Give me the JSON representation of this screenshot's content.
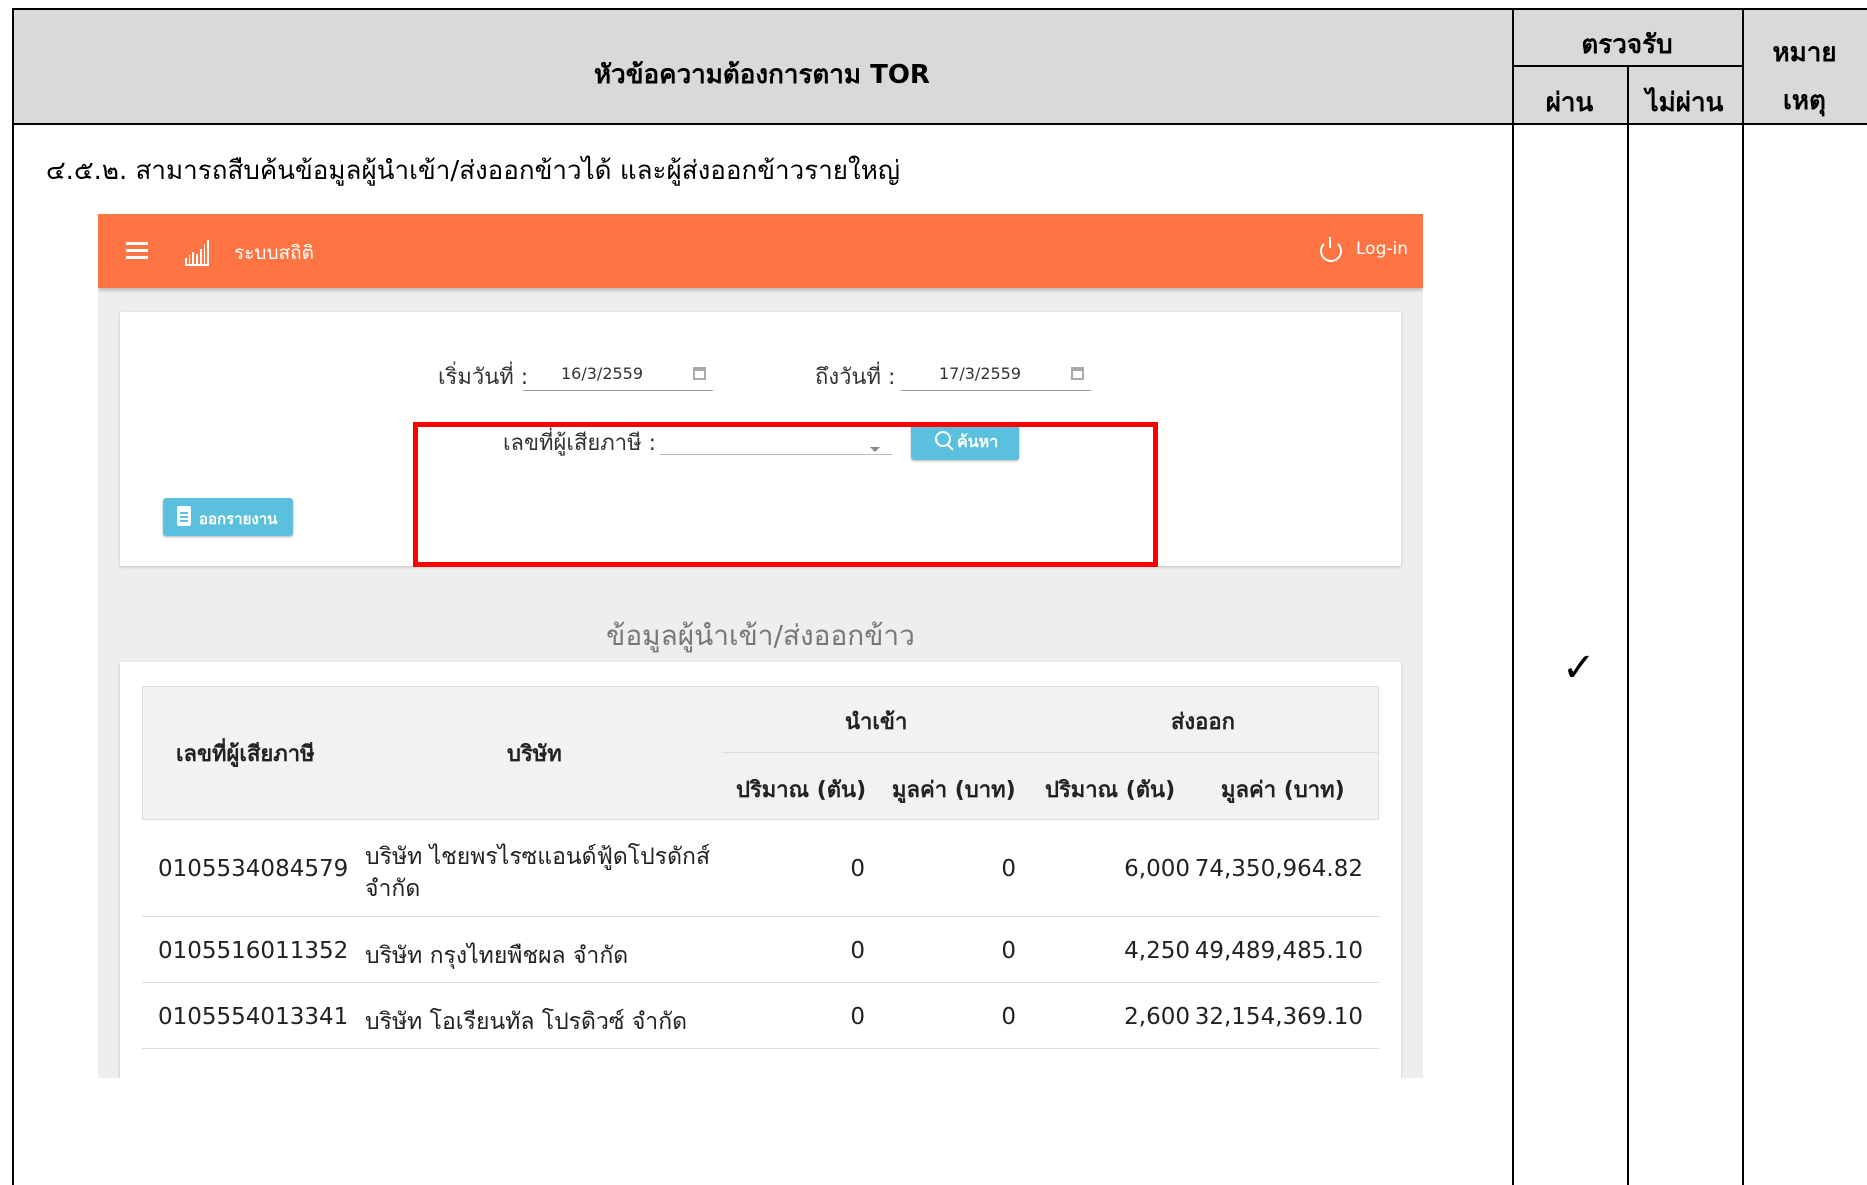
{
  "header": {
    "requirements_title": "หัวข้อความต้องการตาม TOR",
    "acceptance": "ตรวจรับ",
    "pass": "ผ่าน",
    "fail": "ไม่ผ่าน",
    "remarks_line1": "หมาย",
    "remarks_line2": "เหตุ"
  },
  "requirement": {
    "text": "๔.๕.๒. สามารถสืบค้นข้อมูลผู้นำเข้า/ส่งออกข้าวได้ และผู้ส่งออกข้าวรายใหญ่",
    "pass_mark": "✓"
  },
  "app": {
    "title": "ระบบสถิติ",
    "login_label": "Log-in",
    "accent_color": "#ff7443",
    "button_color": "#5bc0de",
    "filters": {
      "start_label": "เริ่มวันที่ :",
      "start_value": "16/3/2559",
      "end_label": "ถึงวันที่ :",
      "end_value": "17/3/2559",
      "taxid_label": "เลขที่ผู้เสียภาษี :",
      "search_button": "ค้นหา",
      "report_button": "ออกรายงาน"
    },
    "section_title": "ข้อมูลผู้นำเข้า/ส่งออกข้าว",
    "table": {
      "col_taxid": "เลขที่ผู้เสียภาษี",
      "col_company": "บริษัท",
      "group_import": "นำเข้า",
      "group_export": "ส่งออก",
      "qty": "ปริมาณ (ตัน)",
      "value": "มูลค่า (บาท)",
      "rows": [
        {
          "taxid": "0105534084579",
          "company_line1": "บริษัท ไชยพรไรซแอนด์ฟู้ดโปรดักส์",
          "company_line2": "จำกัด",
          "imp_qty": "0",
          "imp_val": "0",
          "exp_qty": "6,000",
          "exp_val": "74,350,964.82"
        },
        {
          "taxid": "0105516011352",
          "company_line1": "บริษัท กรุงไทยพืชผล จำกัด",
          "imp_qty": "0",
          "imp_val": "0",
          "exp_qty": "4,250",
          "exp_val": "49,489,485.10"
        },
        {
          "taxid": "0105554013341",
          "company_line1": "บริษัท โอเรียนทัล โปรดิวซ์ จำกัด",
          "imp_qty": "0",
          "imp_val": "0",
          "exp_qty": "2,600",
          "exp_val": "32,154,369.10"
        }
      ]
    }
  }
}
